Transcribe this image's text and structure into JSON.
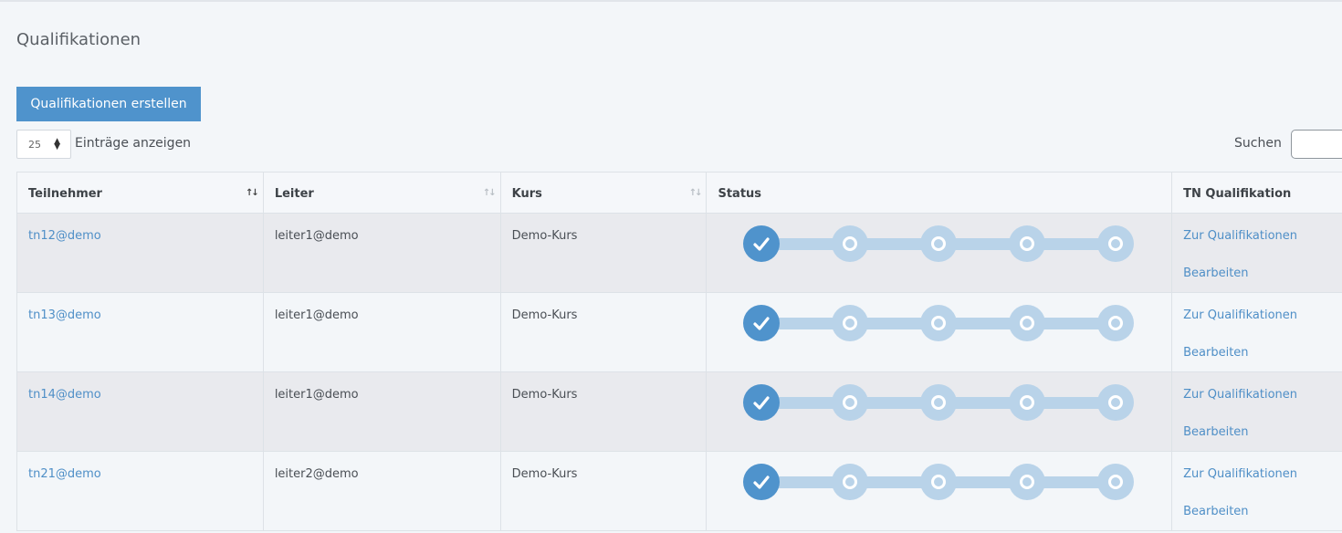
{
  "page": {
    "title": "Qualifikationen"
  },
  "toolbar": {
    "create_label": "Qualifikationen erstellen"
  },
  "table_controls": {
    "page_length": "25",
    "page_length_label": "Einträge anzeigen",
    "search_label": "Suchen",
    "search_value": ""
  },
  "table": {
    "columns": [
      "Teilnehmer",
      "Leiter",
      "Kurs",
      "Status",
      "TN Qualifikation"
    ],
    "rows": [
      {
        "teilnehmer": "tn12@demo",
        "leiter": "leiter1@demo",
        "kurs": "Demo-Kurs",
        "status_completed": 1,
        "status_total": 5,
        "link1": "Zur Qualifikationen",
        "link2": "Bearbeiten"
      },
      {
        "teilnehmer": "tn13@demo",
        "leiter": "leiter1@demo",
        "kurs": "Demo-Kurs",
        "status_completed": 1,
        "status_total": 5,
        "link1": "Zur Qualifikationen",
        "link2": "Bearbeiten"
      },
      {
        "teilnehmer": "tn14@demo",
        "leiter": "leiter1@demo",
        "kurs": "Demo-Kurs",
        "status_completed": 1,
        "status_total": 5,
        "link1": "Zur Qualifikationen",
        "link2": "Bearbeiten"
      },
      {
        "teilnehmer": "tn21@demo",
        "leiter": "leiter2@demo",
        "kurs": "Demo-Kurs",
        "status_completed": 1,
        "status_total": 5,
        "link1": "Zur Qualifikationen",
        "link2": "Bearbeiten"
      }
    ]
  },
  "colors": {
    "accent": "#4f93cc",
    "step_pending": "#b9d3e9",
    "row_shaded": "#e9eaee",
    "background": "#f3f6f9"
  }
}
